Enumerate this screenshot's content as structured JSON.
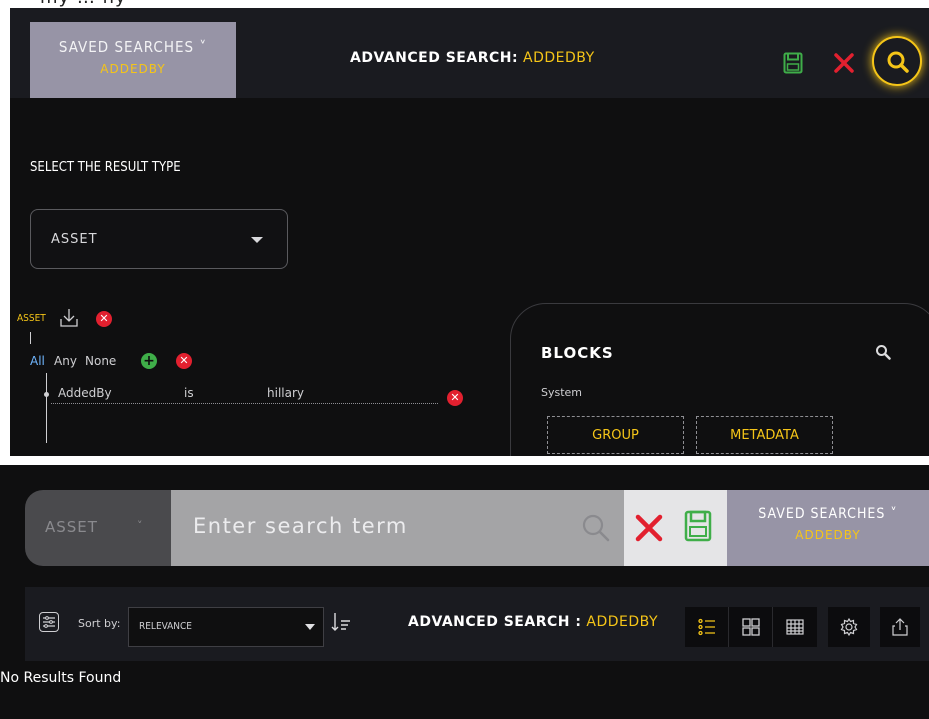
{
  "top": {
    "partial_text": "my … ny"
  },
  "panel1": {
    "saved_searches": {
      "label": "SAVED SEARCHES ˅",
      "current": "ADDEDBY"
    },
    "title_prefix": "ADVANCED SEARCH:",
    "title_value": " ADDEDBY",
    "select_label": "SELECT THE RESULT TYPE",
    "result_type": "ASSET",
    "asset_tag": "ASSET",
    "logic": {
      "all": "All",
      "any": "Any",
      "none": "None"
    },
    "condition": {
      "field": "AddedBy",
      "operator": "is",
      "value": "hillary"
    },
    "blocks": {
      "title": "BLOCKS",
      "section": "System",
      "items": [
        "GROUP",
        "METADATA"
      ]
    },
    "colors": {
      "accent": "#f5c518",
      "save": "#3fae49",
      "close": "#e2202f",
      "saved_bg": "#9794a6"
    }
  },
  "panel2": {
    "search_scope": "ASSET",
    "search_placeholder": "Enter search term",
    "saved_searches": {
      "label": "SAVED SEARCHES ˅",
      "current": "ADDEDBY"
    },
    "sort_by_label": "Sort by:",
    "sort_value": "RELEVANCE",
    "title_prefix": "ADVANCED SEARCH :",
    "title_value": " ADDEDBY",
    "view_icons": [
      "list-view-icon",
      "grid-view-icon",
      "table-view-icon"
    ],
    "no_results": "No Results Found"
  }
}
